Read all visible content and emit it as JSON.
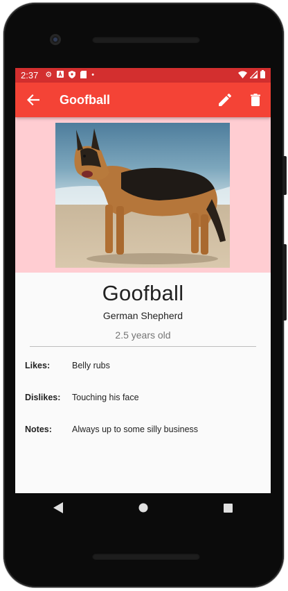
{
  "status_bar": {
    "time": "2:37",
    "icons_left": [
      "gear-icon",
      "a-badge-icon",
      "shield-icon",
      "sd-card-icon",
      "dot-icon"
    ],
    "icons_right": [
      "wifi-icon",
      "signal-icon",
      "battery-icon"
    ]
  },
  "app_bar": {
    "title": "Goofball",
    "color": "#f44336",
    "status_color": "#d32f2f"
  },
  "pet": {
    "name": "Goofball",
    "breed": "German Shepherd",
    "age": "2.5 years old",
    "hero_background": "#ffcdd2"
  },
  "fields": [
    {
      "label": "Likes:",
      "value": "Belly rubs"
    },
    {
      "label": "Dislikes:",
      "value": "Touching his face"
    },
    {
      "label": "Notes:",
      "value": "Always up to some silly business"
    }
  ]
}
